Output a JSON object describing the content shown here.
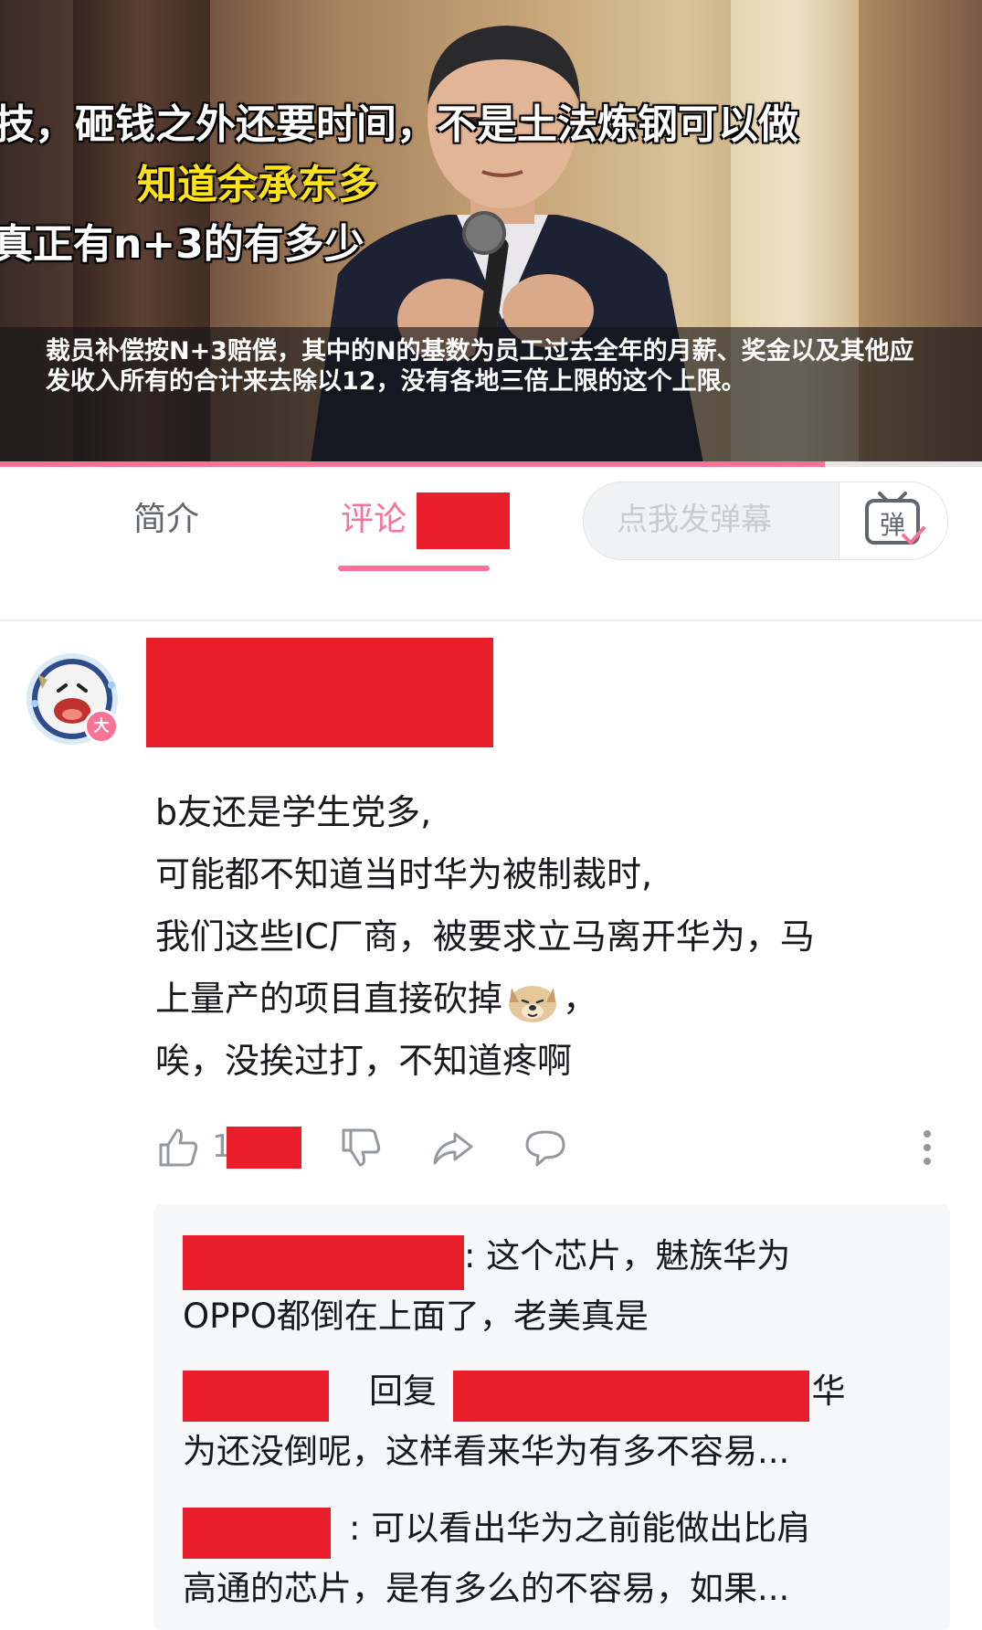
{
  "video": {
    "subtitle_top": "技，砸钱之外还要时间，不是土法炼钢可以做",
    "subtitle_yellow": "知道余承东多",
    "subtitle_mid": "真正有n+3的有多少",
    "caption": "裁员补偿按N+3赔偿，其中的N的基数为员工过去全年的月薪、奖金以及其他应发收入所有的合计来去除以12，没有各地三倍上限的这个上限。",
    "progress": 0.84
  },
  "tabs": {
    "intro": "简介",
    "comments": "评论"
  },
  "danmaku": {
    "placeholder": "点我发弹幕",
    "button_glyph": "弹"
  },
  "colors": {
    "accent": "#fb7299",
    "redaction": "#ea1e2a",
    "text_main": "#18191c",
    "text_muted": "#9499a0"
  },
  "comment": {
    "avatar_badge": "大",
    "lines": [
      "b友还是学生党多,",
      "可能都不知道当时华为被制裁时,",
      "我们这些IC厂商，被要求立马离开华为，马",
      "上量产的项目直接砍掉",
      "，",
      "唉，没挨过打，不知道疼啊"
    ],
    "emoji": "dog-face-emoji",
    "like_count_prefix": "1"
  },
  "icons": {
    "like": "thumbs-up-icon",
    "dislike": "thumbs-down-icon",
    "share": "share-icon",
    "reply": "chat-bubble-icon",
    "more": "more-vertical-icon"
  },
  "replies": [
    {
      "text_line1": ": 这个芯片，魅族华为",
      "text_line2": "OPPO都倒在上面了，老美真是"
    },
    {
      "reply_word": "回复",
      "text_line1_tail": ":华",
      "text_line2": "为还没倒呢，这样看来华为有多不容易..."
    },
    {
      "text_line1": ": 可以看出华为之前能做出比肩",
      "text_line2": "高通的芯片，是有多么的不容易，如果..."
    }
  ]
}
